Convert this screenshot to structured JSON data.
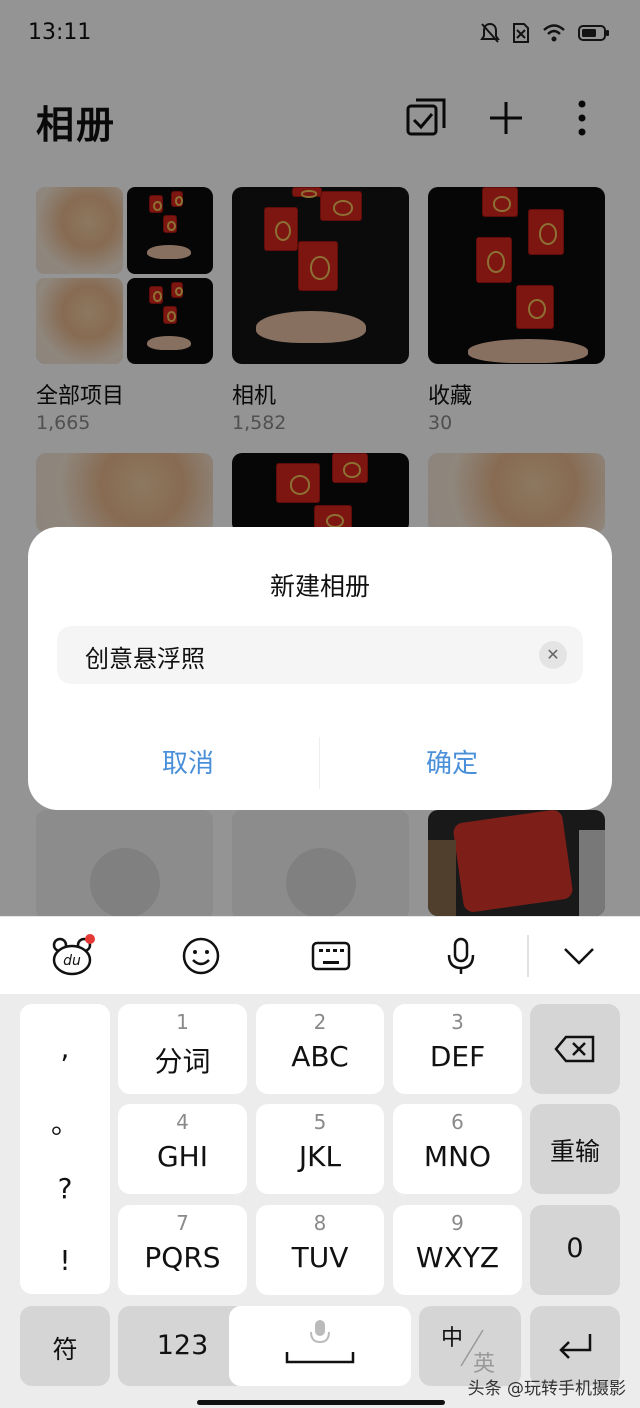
{
  "status_bar": {
    "time": "13:11"
  },
  "header": {
    "title": "相册"
  },
  "albums": [
    {
      "name": "全部项目",
      "count": "1,665"
    },
    {
      "name": "相机",
      "count": "1,582"
    },
    {
      "name": "收藏",
      "count": "30"
    }
  ],
  "dialog": {
    "title": "新建相册",
    "input_value": "创意悬浮照",
    "clear_label": "✕",
    "cancel_label": "取消",
    "confirm_label": "确定",
    "accent_color": "#4a90d9"
  },
  "keyboard": {
    "punctuation": [
      ",",
      "。",
      "?",
      "!"
    ],
    "keys_row1": [
      {
        "num": "1",
        "label": "分词"
      },
      {
        "num": "2",
        "label": "ABC"
      },
      {
        "num": "3",
        "label": "DEF"
      }
    ],
    "keys_row2": [
      {
        "num": "4",
        "label": "GHI"
      },
      {
        "num": "5",
        "label": "JKL"
      },
      {
        "num": "6",
        "label": "MNO"
      }
    ],
    "keys_row3": [
      {
        "num": "7",
        "label": "PQRS"
      },
      {
        "num": "8",
        "label": "TUV"
      },
      {
        "num": "9",
        "label": "WXYZ"
      }
    ],
    "reenter_label": "重输",
    "zero_label": "0",
    "symbol_label": "符",
    "numeric_label": "123",
    "lang_top": "中",
    "lang_bottom": "英"
  },
  "watermark": "头条 @玩转手机摄影"
}
